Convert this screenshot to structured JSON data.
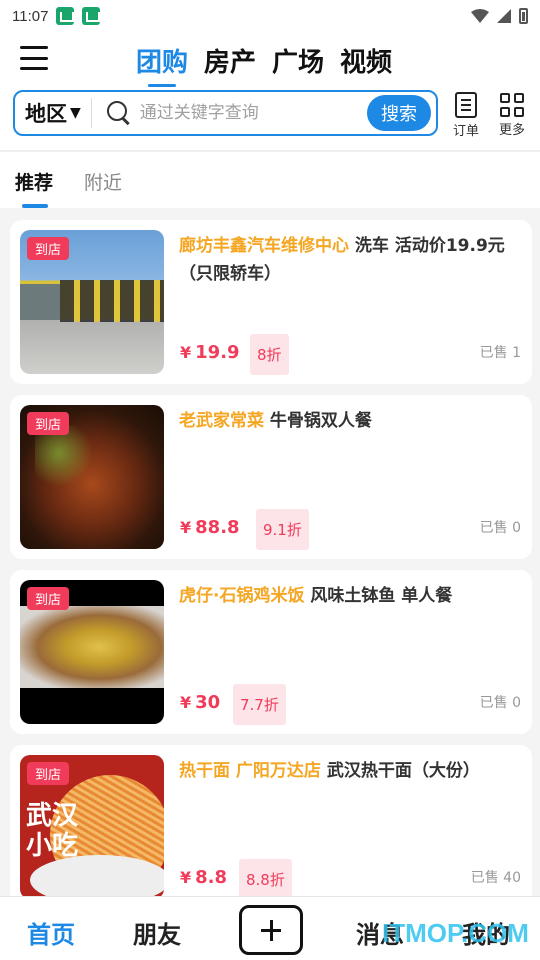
{
  "status_bar": {
    "time": "11:07"
  },
  "header": {
    "tabs": [
      "团购",
      "房产",
      "广场",
      "视频"
    ],
    "active_tab": 0
  },
  "search": {
    "region": "地区",
    "placeholder": "通过关键字查询",
    "button": "搜索"
  },
  "actions": {
    "orders": "订单",
    "more": "更多"
  },
  "sub_tabs": [
    "推荐",
    "附近"
  ],
  "items": [
    {
      "badge": "到店",
      "shop": "廊坊丰鑫汽车维修中心",
      "desc": " 洗车 活动价19.9元（只限轿车）",
      "yen": "¥",
      "price": "19.9",
      "discount": "8折",
      "sold": "已售 1"
    },
    {
      "badge": "到店",
      "shop": "老武家常菜",
      "desc": " 牛骨锅双人餐",
      "yen": "¥",
      "price": "88.8",
      "discount": "9.1折",
      "sold": "已售 0"
    },
    {
      "badge": "到店",
      "shop": "虎仔·石锅鸡米饭",
      "desc": " 风味土钵鱼 单人餐",
      "yen": "¥",
      "price": "30",
      "discount": "7.7折",
      "sold": "已售 0"
    },
    {
      "badge": "到店",
      "shop": "热干面 广阳万达店",
      "desc": " 武汉热干面（大份）",
      "yen": "¥",
      "price": "8.8",
      "discount": "8.8折",
      "sold": "已售 40",
      "image_text": "武汉\n小吃"
    }
  ],
  "bottom_nav": [
    "首页",
    "朋友",
    "消息",
    "我的"
  ],
  "watermark": "ITMOP.COM",
  "colors": {
    "accent": "#1e88e5",
    "price": "#f03c5a",
    "shop": "#f5a623"
  }
}
